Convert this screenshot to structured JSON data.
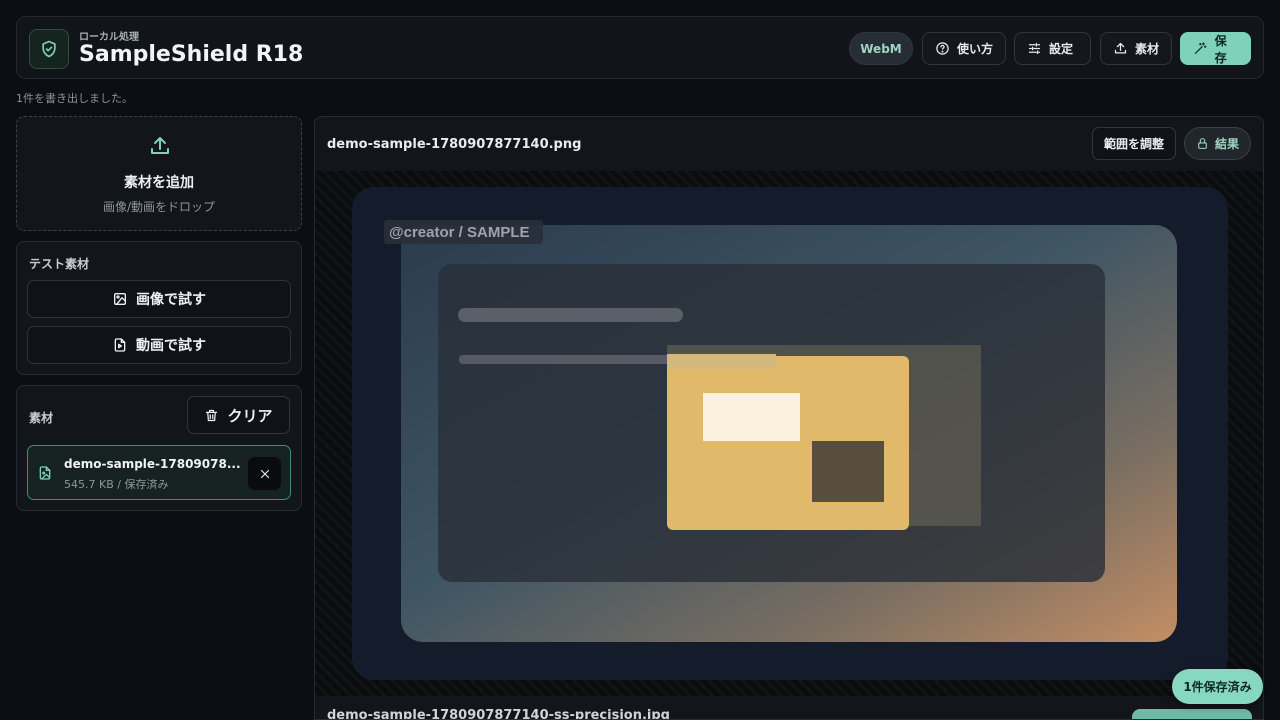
{
  "app": {
    "subtitle": "ローカル処理",
    "title": "SampleShield R18"
  },
  "header": {
    "webm_label": "WebM",
    "help_label": "使い方",
    "settings_label": "設定",
    "assets_label": "素材",
    "save_label": "保存"
  },
  "status_text": "1件を書き出しました。",
  "dropzone": {
    "title": "素材を追加",
    "hint": "画像/動画をドロップ"
  },
  "test_panel": {
    "title": "テスト素材",
    "image_button": "画像で試す",
    "video_button": "動画で試す"
  },
  "assets_panel": {
    "title": "素材",
    "clear_button": "クリア",
    "items": [
      {
        "name": "demo-sample-17809078...",
        "meta": "545.7 KB / 保存済み"
      }
    ]
  },
  "preview": {
    "file_name": "demo-sample-1780907877140.png",
    "range_button": "範囲を調整",
    "result_button": "結果",
    "watermark": "@creator / SAMPLE",
    "next_file_name": "demo-sample-1780907877140-ss-precision.jpg"
  },
  "saved_badge": "1件保存済み",
  "colors": {
    "accent": "#7fd1b9",
    "background": "#0b0e12",
    "panel": "#12161b"
  }
}
